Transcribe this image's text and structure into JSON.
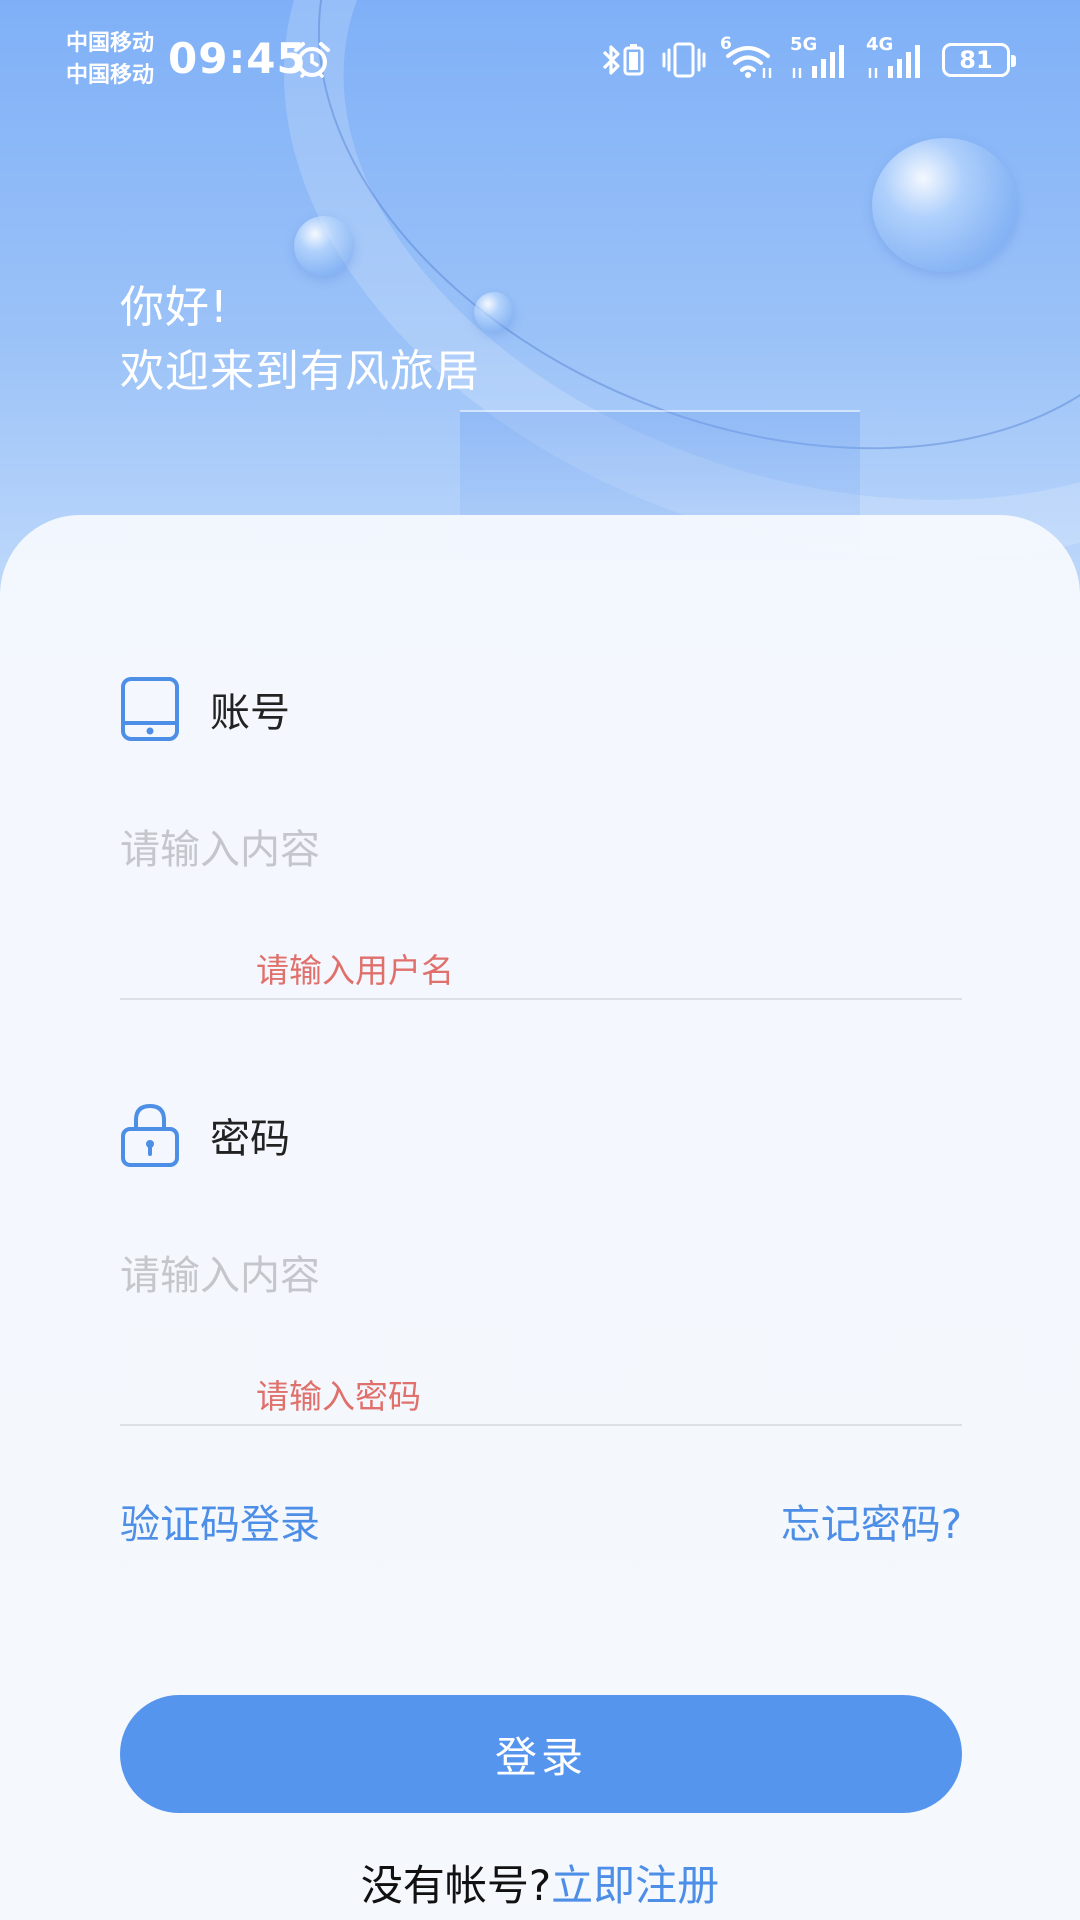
{
  "status_bar": {
    "carrier_1": "中国移动",
    "carrier_2": "中国移动",
    "time": "09:45",
    "wifi_badge": "6",
    "net_1": "5G",
    "net_2": "4G",
    "battery_level": "81",
    "icons": [
      "alarm-icon",
      "bluetooth-icon",
      "vibrate-icon",
      "wifi-icon",
      "signal-5g-icon",
      "signal-4g-icon",
      "battery-icon"
    ]
  },
  "greeting": {
    "line1": "你好!",
    "line2": "欢迎来到有风旅居"
  },
  "account": {
    "label": "账号",
    "placeholder": "请输入内容",
    "value": "",
    "error": "请输入用户名",
    "icon": "tablet-icon"
  },
  "password": {
    "label": "密码",
    "placeholder": "请输入内容",
    "value": "",
    "error": "请输入密码",
    "icon": "lock-icon"
  },
  "links": {
    "sms_login": "验证码登录",
    "forgot_password": "忘记密码?"
  },
  "login_button": "登录",
  "register": {
    "prompt": "没有帐号?",
    "link": "立即注册"
  },
  "colors": {
    "accent": "#5595ee",
    "link": "#4d8ee6",
    "error": "#e0706b",
    "placeholder": "#c4c6cb"
  }
}
